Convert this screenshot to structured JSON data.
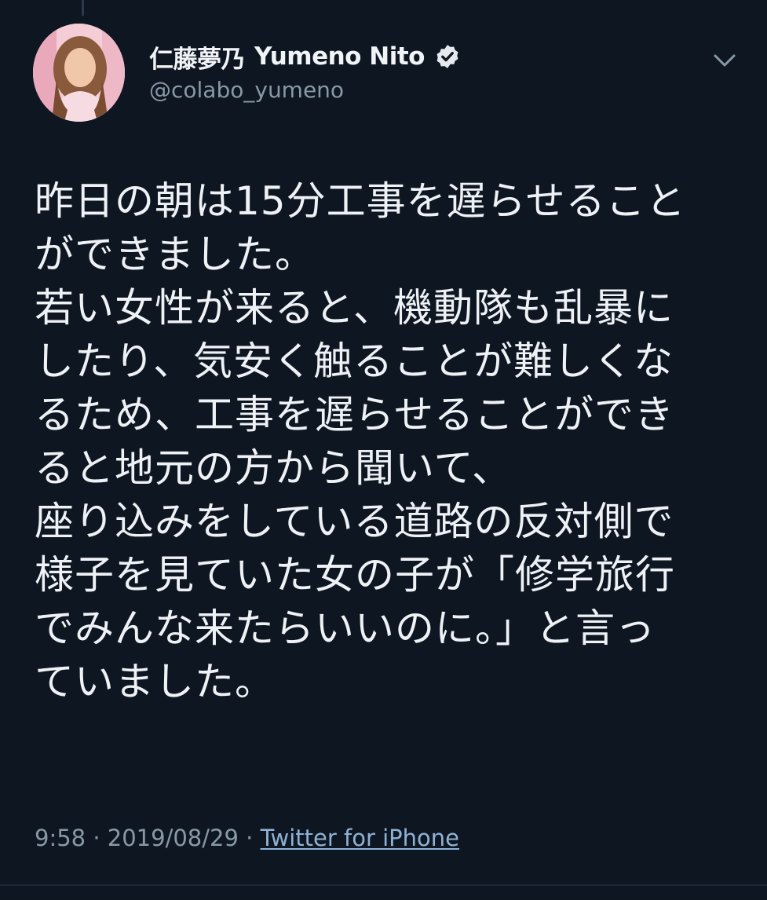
{
  "tweet": {
    "display_name": "仁藤夢乃",
    "display_name_en": "Yumeno Nito",
    "handle": "@colabo_yumeno",
    "verified": true,
    "lines": [
      "昨日の朝は15分工事を遅らせること",
      "ができました。",
      "若い女性が来ると、機動隊も乱暴に",
      "したり、気安く触ることが難しくな",
      "るため、工事を遅らせることができ",
      "ると地元の方から聞いて、",
      "座り込みをしている道路の反対側で",
      "様子を見ていた女の子が「修学旅行",
      "でみんな来たらいいのに。」と言っ",
      "ていました。"
    ],
    "time": "9:58",
    "date": "2019/08/29",
    "separator": "·",
    "source": "Twitter for iPhone"
  },
  "icons": {
    "verified": "verified-badge-icon",
    "menu": "chevron-down-icon"
  },
  "colors": {
    "background": "#0e1621",
    "text": "#eef2f6",
    "muted": "#8899a6",
    "link": "#8fb2d4"
  }
}
